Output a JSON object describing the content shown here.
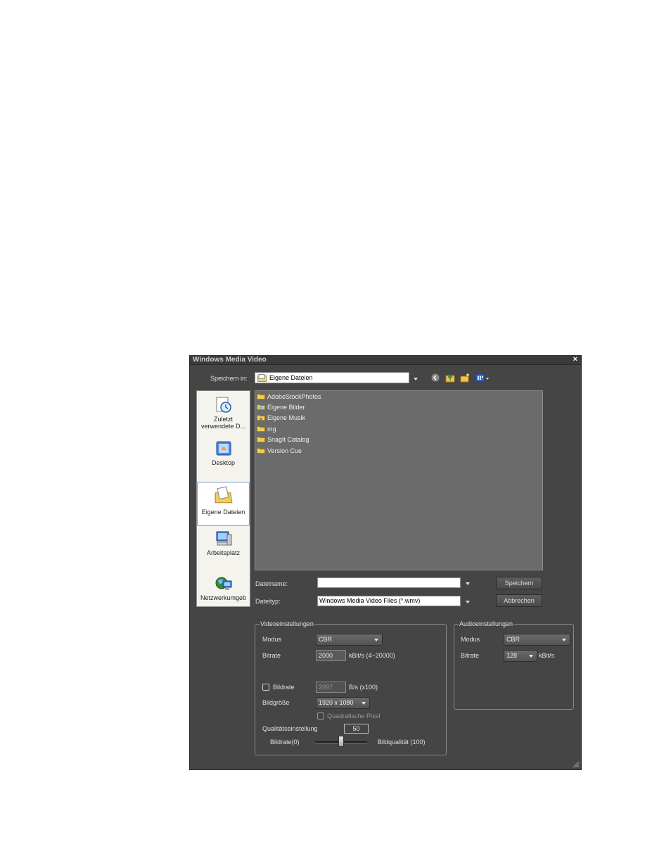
{
  "window": {
    "title": "Windows Media Video",
    "close": "×"
  },
  "save_in": {
    "label": "Speichern in:",
    "value": "Eigene Dateien"
  },
  "toolbar": {
    "back_icon": "back-icon",
    "up_icon": "up-folder-icon",
    "new_folder_icon": "new-folder-icon",
    "view_icon": "view-menu-icon"
  },
  "places": [
    {
      "label": "Zuletzt verwendete D...",
      "icon": "recent-icon"
    },
    {
      "label": "Desktop",
      "icon": "desktop-icon"
    },
    {
      "label": "Eigene Dateien",
      "icon": "my-documents-icon"
    },
    {
      "label": "Arbeitsplatz",
      "icon": "computer-icon"
    },
    {
      "label": "Netzwerkumgeb",
      "icon": "network-icon"
    }
  ],
  "files": [
    {
      "name": "AdobeStockPhotos",
      "icon": "folder-icon"
    },
    {
      "name": "Eigene Bilder",
      "icon": "pictures-folder-icon"
    },
    {
      "name": "Eigene Musik",
      "icon": "music-folder-icon"
    },
    {
      "name": "mg",
      "icon": "folder-icon"
    },
    {
      "name": "SnagIt Catalog",
      "icon": "folder-icon"
    },
    {
      "name": "Version Cue",
      "icon": "folder-icon"
    }
  ],
  "filename": {
    "label": "Dateiname:",
    "value": ""
  },
  "filetype": {
    "label": "Dateityp:",
    "value": "Windows Media Video Files (*.wmv)"
  },
  "buttons": {
    "save": "Speichern",
    "cancel": "Abbrechen"
  },
  "video": {
    "legend": "Videoeinstellungen",
    "mode_label": "Modus",
    "mode_value": "CBR",
    "bitrate_label": "Bitrate",
    "bitrate_value": "2000",
    "bitrate_unit": "kBit/s (4~20000)",
    "framerate_label": "Bildrate",
    "framerate_value": "2997",
    "framerate_unit": "B/s (x100)",
    "framesize_label": "Bildgröße",
    "framesize_value": "1920 x 1080",
    "square_pixel_label": "Quadratische Pixel",
    "quality_label": "Qualitätseinstellung",
    "quality_value": "50",
    "slider_left": "Bildrate(0)",
    "slider_right": "Bildqualität (100)",
    "slider_fraction": 0.5
  },
  "audio": {
    "legend": "Audioeinstellungen",
    "mode_label": "Modus",
    "mode_value": "CBR",
    "bitrate_label": "Bitrate",
    "bitrate_value": "128",
    "bitrate_unit": "kBit/s"
  }
}
